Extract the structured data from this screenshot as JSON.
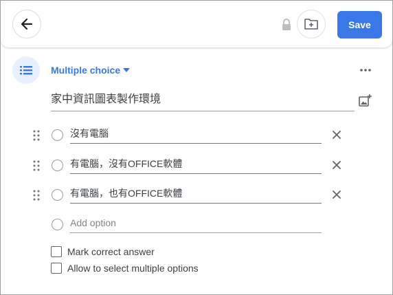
{
  "header": {
    "back_icon": "arrow-left-icon",
    "lock_icon": "lock-icon",
    "folder_icon": "folder-plus-icon",
    "save_label": "Save",
    "accent_color": "#3b78e7"
  },
  "question": {
    "type_icon": "list-icon",
    "type_label": "Multiple choice",
    "more_icon": "more-horizontal-icon",
    "title": "家中資訊圖表製作環境",
    "image_icon": "add-image-icon"
  },
  "options": [
    {
      "label": "沒有電腦"
    },
    {
      "label": "有電腦，沒有OFFICE軟體"
    },
    {
      "label": "有電腦，也有OFFICE軟體"
    }
  ],
  "add_option_placeholder": "Add option",
  "settings": {
    "mark_correct": "Mark correct answer",
    "allow_multiple": "Allow to select multiple options"
  }
}
